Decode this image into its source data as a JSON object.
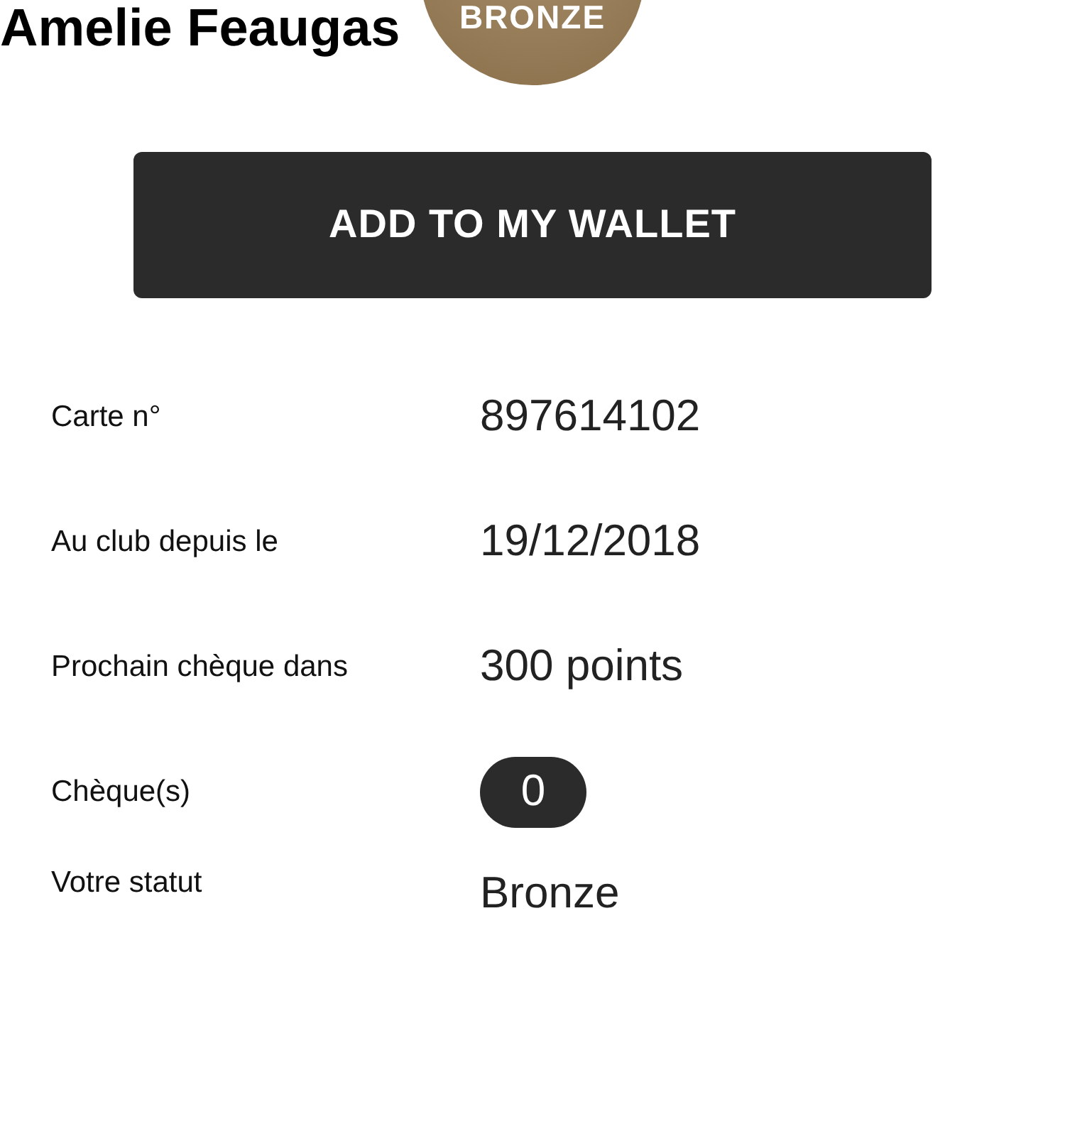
{
  "badge": {
    "label": "BRONZE"
  },
  "name": "Amelie Feaugas",
  "wallet_button": "ADD TO MY WALLET",
  "details": [
    {
      "kind": "text",
      "label": "Carte n°",
      "value": "897614102"
    },
    {
      "kind": "text",
      "label": "Au club depuis le",
      "value": "19/12/2018"
    },
    {
      "kind": "text",
      "label": "Prochain chèque dans",
      "value": "300 points"
    },
    {
      "kind": "pill",
      "label": "Chèque(s)",
      "value": "0"
    },
    {
      "kind": "text",
      "label": "Votre statut",
      "value": "Bronze"
    }
  ]
}
